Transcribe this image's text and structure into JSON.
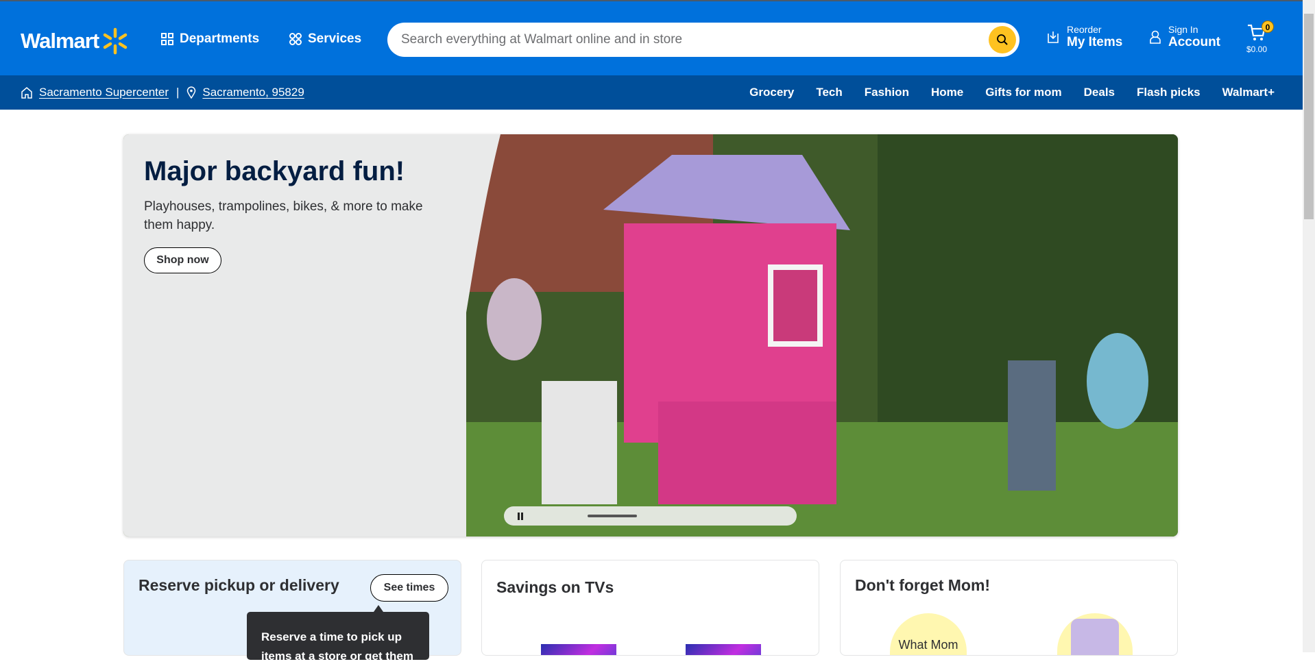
{
  "header": {
    "logo": "Walmart",
    "departments": "Departments",
    "services": "Services",
    "search_placeholder": "Search everything at Walmart online and in store",
    "reorder_small": "Reorder",
    "reorder_big": "My Items",
    "signin_small": "Sign In",
    "signin_big": "Account",
    "cart_count": "0",
    "cart_total": "$0.00"
  },
  "subnav": {
    "store": "Sacramento Supercenter",
    "separator": "|",
    "location": "Sacramento, 95829",
    "categories": [
      "Grocery",
      "Tech",
      "Fashion",
      "Home",
      "Gifts for mom",
      "Deals",
      "Flash picks",
      "Walmart+"
    ]
  },
  "hero": {
    "title": "Major backyard fun!",
    "subtitle": "Playhouses, trampolines, bikes, & more to make them happy.",
    "cta": "Shop now"
  },
  "cards": [
    {
      "title": "Reserve pickup or delivery",
      "button": "See times",
      "tooltip": "Reserve a time to pick up items at a store or get them"
    },
    {
      "title": "Savings on TVs"
    },
    {
      "title": "Don't forget Mom!",
      "badge_text": "What Mom"
    }
  ],
  "colors": {
    "primary": "#0071dc",
    "secondary": "#004f9a",
    "accent": "#ffc220"
  }
}
